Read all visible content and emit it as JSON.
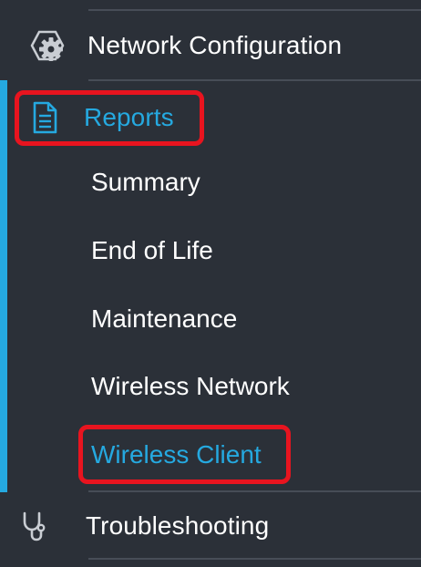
{
  "sidebar": {
    "network_configuration": {
      "label": "Network Configuration",
      "icon": "gear-icon"
    },
    "reports": {
      "label": "Reports",
      "icon": "document-icon",
      "active": true,
      "sub_items": [
        {
          "label": "Summary"
        },
        {
          "label": "End of Life"
        },
        {
          "label": "Maintenance"
        },
        {
          "label": "Wireless Network"
        },
        {
          "label": "Wireless Client",
          "active": true
        }
      ]
    },
    "troubleshooting": {
      "label": "Troubleshooting",
      "icon": "stethoscope-icon"
    }
  },
  "colors": {
    "background": "#2b3038",
    "accent": "#25a9e0",
    "highlight": "#e8141f",
    "separator": "#474d57",
    "text": "#ffffff"
  }
}
